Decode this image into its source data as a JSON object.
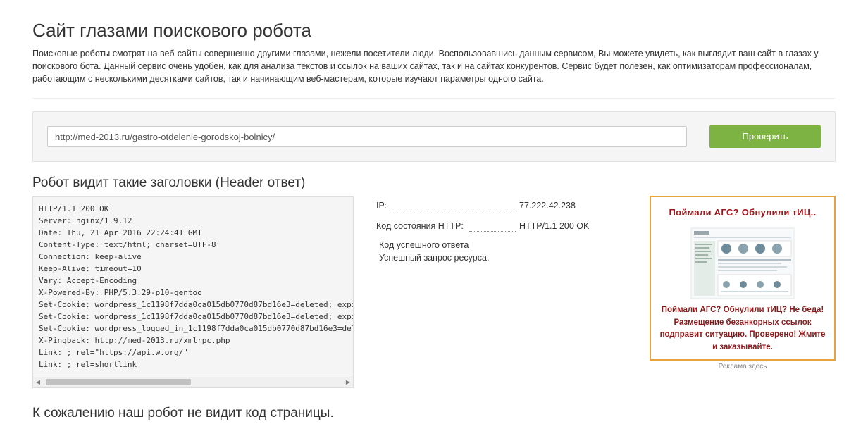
{
  "page": {
    "title": "Сайт глазами поискового робота",
    "intro": "Поисковые роботы смотрят на веб-сайты совершенно другими глазами, нежели посетители люди. Воспользовавшись данным сервисом, Вы можете увидеть, как выглядит ваш сайт в глазах у поискового бота. Данный сервис очень удобен, как для анализа текстов и ссылок на ваших сайтах, так и на сайтах конкурентов. Сервис будет полезен, как оптимизаторам профессионалам, работающим с несколькими десятками сайтов, так и начинающим веб-мастерам, которые изучают параметры одного сайта."
  },
  "check": {
    "url_value": "http://med-2013.ru/gastro-otdelenie-gorodskoj-bolnicy/",
    "button_label": "Проверить"
  },
  "headers": {
    "title": "Робот видит такие заголовки (Header ответ)",
    "lines": [
      "HTTP/1.1 200 OK",
      "Server: nginx/1.9.12",
      "Date: Thu, 21 Apr 2016 22:24:41 GMT",
      "Content-Type: text/html; charset=UTF-8",
      "Connection: keep-alive",
      "Keep-Alive: timeout=10",
      "Vary: Accept-Encoding",
      "X-Powered-By: PHP/5.3.29-p10-gentoo",
      "Set-Cookie: wordpress_1c1198f7dda0ca015db0770d87bd16e3=deleted; expi",
      "Set-Cookie: wordpress_1c1198f7dda0ca015db0770d87bd16e3=deleted; expi",
      "Set-Cookie: wordpress_logged_in_1c1198f7dda0ca015db0770d87bd16e3=del",
      "X-Pingback: http://med-2013.ru/xmlrpc.php",
      "Link: ; rel=\"https://api.w.org/\"",
      "Link: ; rel=shortlink"
    ]
  },
  "info": {
    "ip_label": "IP:",
    "ip_value": "77.222.42.238",
    "status_label": "Код состояния HTTP:",
    "status_value": "HTTP/1.1 200 OK",
    "success_link": "Код успешного ответа",
    "success_desc": "Успешный запрос ресурса."
  },
  "ad": {
    "title": "Поймали АГС? Обнулили тИЦ..",
    "text": "Поймали АГС? Обнулили тИЦ? Не беда! Размещение безанкорных ссылок подправит ситуацию. Проверено! Жмите и заказывайте.",
    "caption": "Реклама здесь",
    "border_color": "#e8a33c",
    "title_color": "#a3151b"
  },
  "bottom": {
    "title": "К сожалению наш робот не видит код страницы."
  },
  "colors": {
    "button": "#7cb342",
    "panel_bg": "#f5f5f5"
  }
}
